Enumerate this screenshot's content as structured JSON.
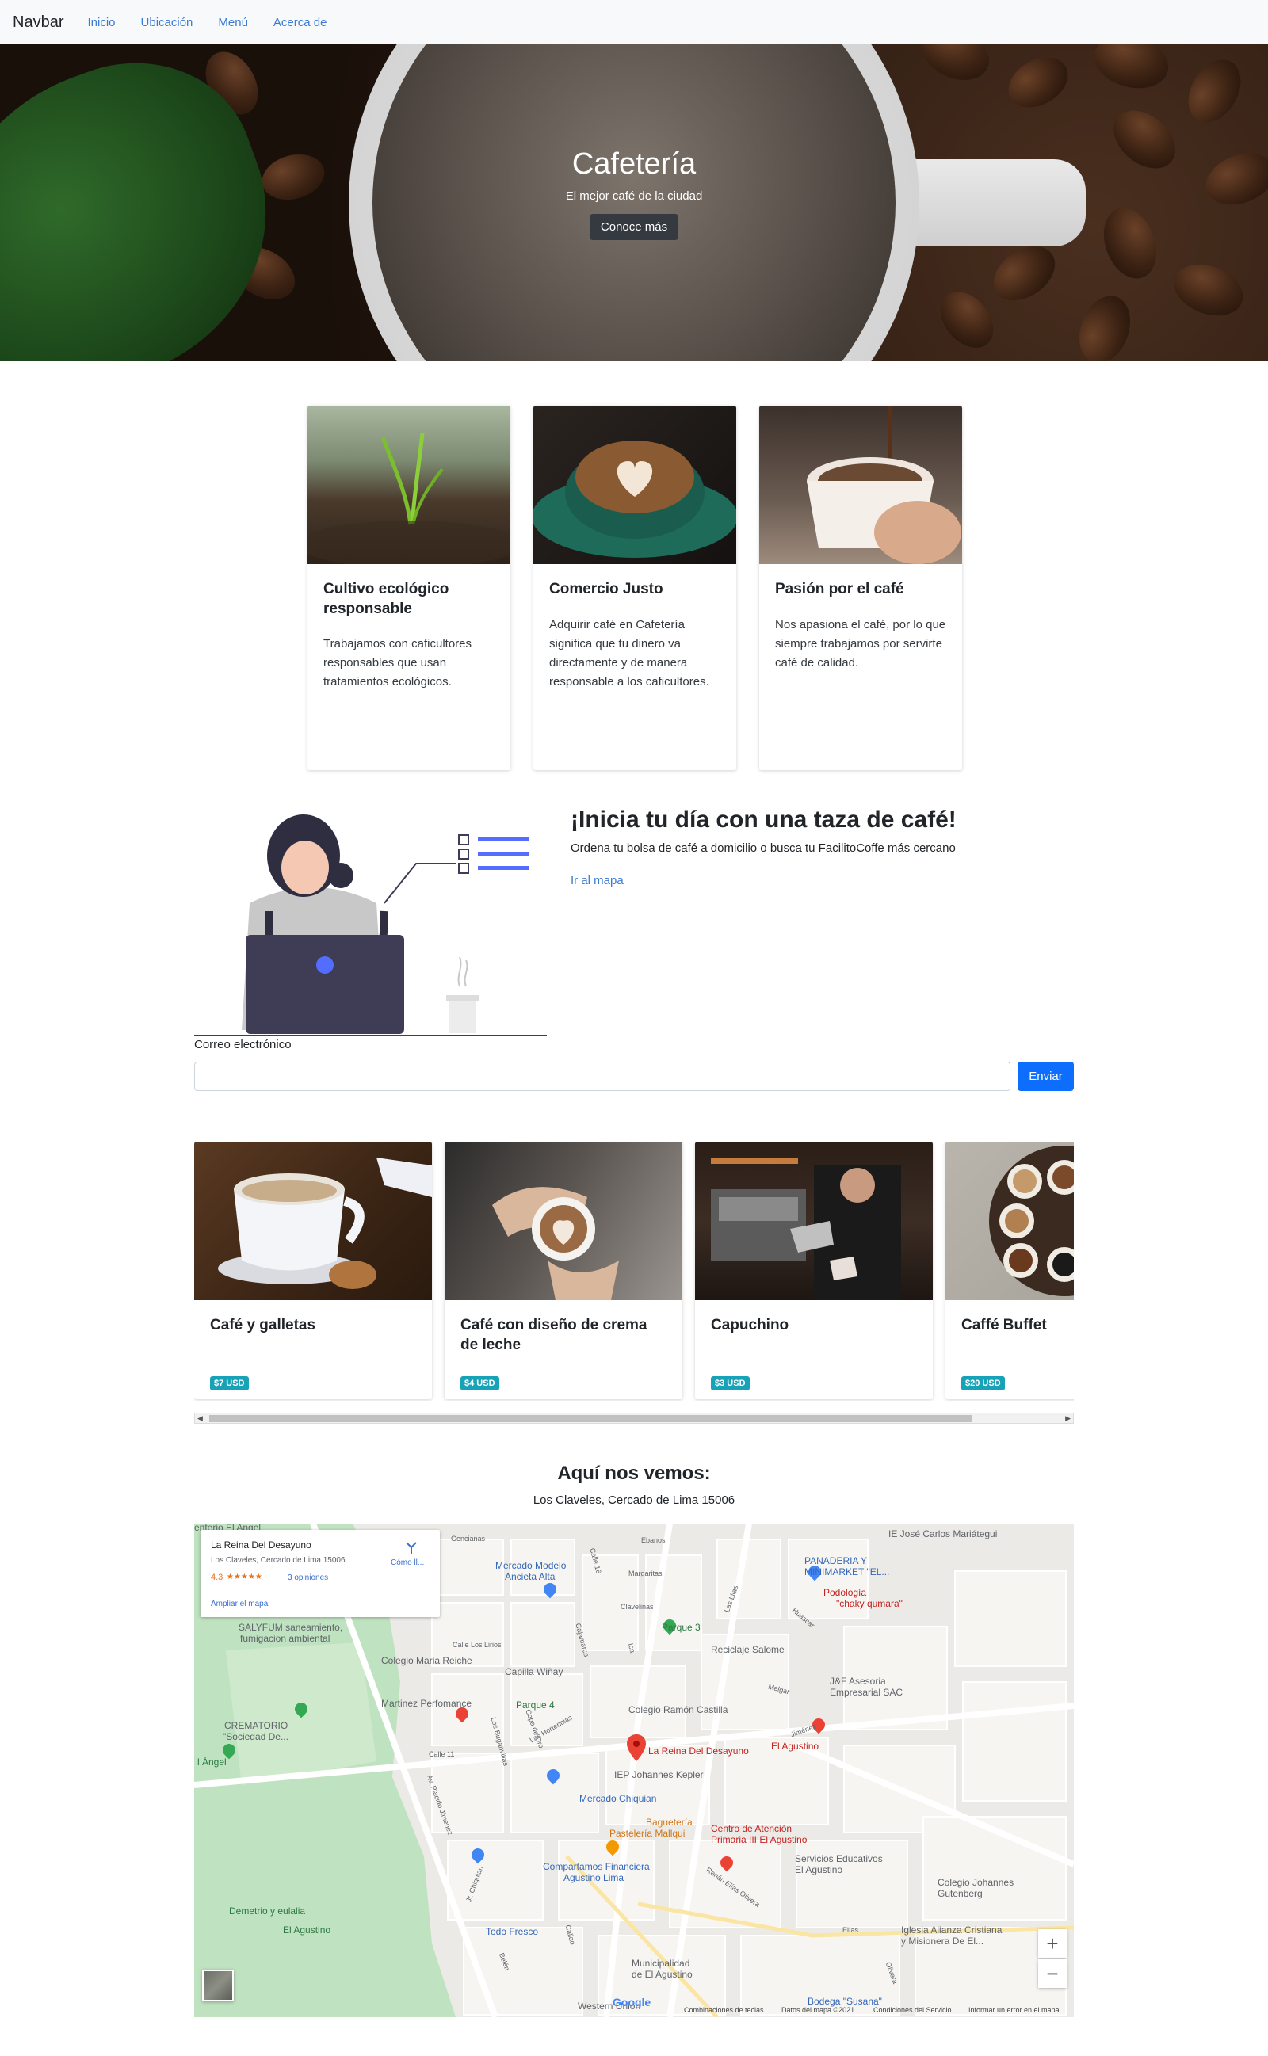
{
  "navbar": {
    "brand": "Navbar",
    "links": [
      "Inicio",
      "Ubicación",
      "Menú",
      "Acerca de"
    ]
  },
  "hero": {
    "title": "Cafetería",
    "subtitle": "El mejor café de la ciudad",
    "button": "Conoce más"
  },
  "features": [
    {
      "title": "Cultivo ecológico responsable",
      "text": "Trabajamos con caficultores responsables que usan tratamientos ecológicos."
    },
    {
      "title": "Comercio Justo",
      "text": "Adquirir café en Cafetería significa que tu dinero va directamente y de manera responsable a los caficultores."
    },
    {
      "title": "Pasión por el café",
      "text": "Nos apasiona el café, por lo que siempre trabajamos por servirte café de calidad."
    }
  ],
  "cta": {
    "title": "¡Inicia tu día con una taza de café!",
    "text": "Ordena tu bolsa de café a domicilio o busca tu FacilitoCoffe más cercano",
    "link": "Ir al mapa"
  },
  "subscribe": {
    "label": "Correo electrónico",
    "input_value": "",
    "button": "Enviar"
  },
  "products": [
    {
      "title": "Café y galletas",
      "price": "$7 USD"
    },
    {
      "title": "Café con diseño de crema de leche",
      "price": "$4 USD"
    },
    {
      "title": "Capuchino",
      "price": "$3 USD"
    },
    {
      "title": "Caffé Buffet",
      "price": "$20 USD"
    }
  ],
  "location": {
    "title": "Aquí nos vemos:",
    "address": "Los Claveles, Cercado de Lima 15006"
  },
  "map": {
    "place_name": "La Reina Del Desayuno",
    "place_address": "Los Claveles, Cercado de Lima 15006",
    "rating": "4.3",
    "stars": "★★★★★",
    "reviews": "3 opiniones",
    "directions": "Cómo ll...",
    "enlarge": "Ampliar el mapa",
    "zoom_in": "+",
    "zoom_out": "−",
    "google": "Google",
    "footer": [
      "Combinaciones de teclas",
      "Datos del mapa ©2021",
      "Condiciones del Servicio",
      "Informar un error en el mapa"
    ],
    "labels": [
      {
        "text": "enterio El Angel",
        "cls": "lbl-gray"
      },
      {
        "text": "IE José Carlos Mariátegui",
        "cls": "lbl-gray"
      },
      {
        "text": "PANADERIA Y",
        "cls": "lbl-blue"
      },
      {
        "text": "MINIMARKET \"EL...",
        "cls": "lbl-blue"
      },
      {
        "text": "Mercado Modelo",
        "cls": "lbl-blue"
      },
      {
        "text": "Ancieta Alta",
        "cls": "lbl-blue"
      },
      {
        "text": "Podología",
        "cls": "lbl-red"
      },
      {
        "text": "\"chaky qumara\"",
        "cls": "lbl-red"
      },
      {
        "text": "SALYFUM saneamiento,",
        "cls": "lbl-gray"
      },
      {
        "text": "fumigacion ambiental",
        "cls": "lbl-gray"
      },
      {
        "text": "Parque 3",
        "cls": "lbl-green"
      },
      {
        "text": "Colegio Maria Reiche",
        "cls": "lbl-gray"
      },
      {
        "text": "Capilla Wiñay",
        "cls": "lbl-gray"
      },
      {
        "text": "Reciclaje Salome",
        "cls": "lbl-gray"
      },
      {
        "text": "J&F Asesoria",
        "cls": "lbl-gray"
      },
      {
        "text": "Empresarial SAC",
        "cls": "lbl-gray"
      },
      {
        "text": "Martinez Perfomance",
        "cls": "lbl-gray"
      },
      {
        "text": "Parque 4",
        "cls": "lbl-green"
      },
      {
        "text": "Colegio Ramón Castilla",
        "cls": "lbl-gray"
      },
      {
        "text": "CREMATORIO",
        "cls": "lbl-gray"
      },
      {
        "text": "\"Sociedad De...",
        "cls": "lbl-gray"
      },
      {
        "text": "El Agustino",
        "cls": "lbl-red"
      },
      {
        "text": "La Reina Del Desayuno",
        "cls": "lbl-red"
      },
      {
        "text": "IEP Johannes Kepler",
        "cls": "lbl-gray"
      },
      {
        "text": "l Ángel",
        "cls": "lbl-green"
      },
      {
        "text": "Mercado Chiquian",
        "cls": "lbl-blue"
      },
      {
        "text": "Baguetería",
        "cls": "lbl-orange"
      },
      {
        "text": "Pastelería Mallqui",
        "cls": "lbl-orange"
      },
      {
        "text": "Centro de Atención",
        "cls": "lbl-red"
      },
      {
        "text": "Primaria III El Agustino",
        "cls": "lbl-red"
      },
      {
        "text": "Servicios Educativos",
        "cls": "lbl-gray"
      },
      {
        "text": "El Agustino",
        "cls": "lbl-gray"
      },
      {
        "text": "Compartamos Financiera",
        "cls": "lbl-blue"
      },
      {
        "text": "Agustino Lima",
        "cls": "lbl-blue"
      },
      {
        "text": "Colegio Johannes",
        "cls": "lbl-gray"
      },
      {
        "text": "Gutenberg",
        "cls": "lbl-gray"
      },
      {
        "text": "Demetrio y eulalia",
        "cls": "lbl-green"
      },
      {
        "text": "El Agustino",
        "cls": "lbl-green"
      },
      {
        "text": "Todo Fresco",
        "cls": "lbl-blue"
      },
      {
        "text": "Iglesia Alianza Cristiana",
        "cls": "lbl-gray"
      },
      {
        "text": "y Misionera De El...",
        "cls": "lbl-gray"
      },
      {
        "text": "Municipalidad",
        "cls": "lbl-gray"
      },
      {
        "text": "de El Agustino",
        "cls": "lbl-gray"
      },
      {
        "text": "Western Union",
        "cls": "lbl-gray"
      },
      {
        "text": "Bodega \"Susana\"",
        "cls": "lbl-blue"
      }
    ],
    "streets": [
      "Gencianas",
      "Ebanos",
      "Margaritas",
      "Clavelinas",
      "Calle Los Lirios",
      "Calle 11",
      "Av. Placido Jimenez",
      "Los Buganvilias",
      "Copa de Oro",
      "Las Hortencias",
      "Melgar",
      "Huascar",
      "Av. Ricardo Palma",
      "Jr. Chiquian",
      "Renán Elías Olivera",
      "Elías",
      "Olivera",
      "Callao",
      "Belén",
      "Las Lilas",
      "Ica",
      "Jiménez",
      "Pl. Dos de Mayo",
      "Calle 16",
      "Cajamarca"
    ]
  }
}
